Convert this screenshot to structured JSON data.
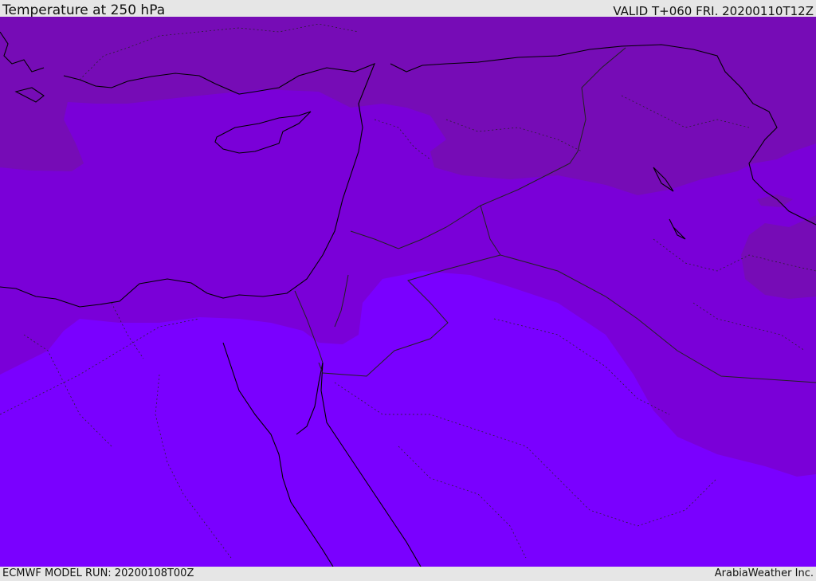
{
  "header": {
    "title": "Temperature at 250 hPa",
    "valid_time": "VALID T+060 FRI. 20200110T12Z"
  },
  "footer": {
    "model_run": "ECMWF MODEL RUN: 20200108T00Z",
    "credit": "ArabiaWeather Inc."
  },
  "map": {
    "variable": "Temperature at 250 hPa",
    "colors": {
      "coldest": "#760cb6",
      "cold": "#7a00d8",
      "mild": "#7a00ff",
      "coastline": "#000000",
      "border": "#222222"
    }
  }
}
